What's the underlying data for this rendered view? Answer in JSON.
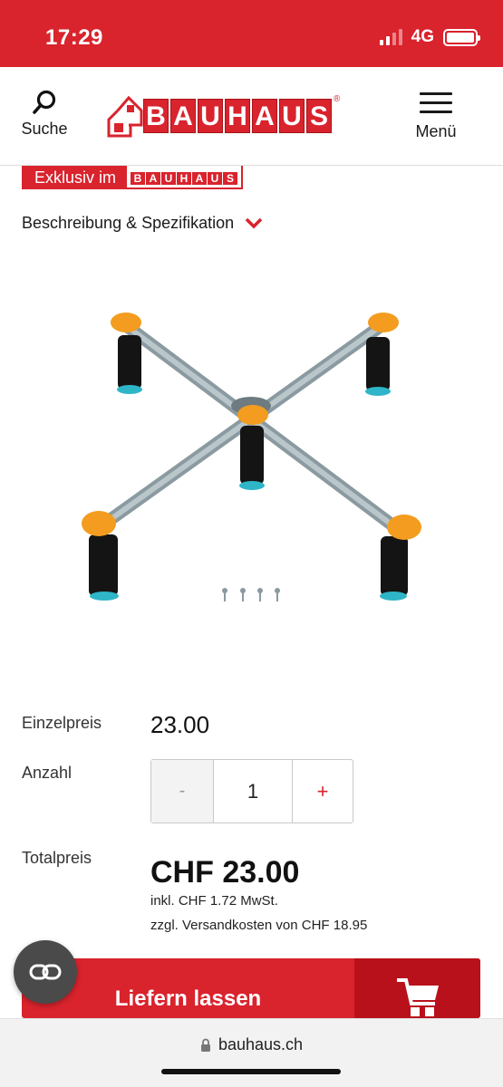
{
  "status_bar": {
    "time": "17:29",
    "network": "4G",
    "battery_level": 1.0,
    "signal_bars_active": 2,
    "signal_bars_total": 4
  },
  "header": {
    "search_label": "Suche",
    "menu_label": "Menü",
    "logo_text": "BAUHAUS",
    "logo_registered": "®"
  },
  "badge": {
    "text": "Exklusiv im",
    "logo_text": "BAUHAUS"
  },
  "description": {
    "label": "Beschreibung & Spezifikation"
  },
  "product": {
    "image": "shower-tray-support-frame"
  },
  "pricing": {
    "unit_price_label": "Einzelpreis",
    "unit_price": "23.00",
    "quantity_label": "Anzahl",
    "quantity_minus": "-",
    "quantity_value": "1",
    "quantity_plus": "+",
    "total_label": "Totalpreis",
    "total_price": "CHF 23.00",
    "vat_note": "inkl. CHF 1.72 MwSt.",
    "shipping_note": "zzgl. Versandkosten von CHF 18.95"
  },
  "deliver_button": {
    "label": "Liefern lassen",
    "icon": "cart-icon"
  },
  "browser": {
    "url": "bauhaus.ch"
  },
  "colors": {
    "brand_red": "#d9232d",
    "brand_dark_red": "#b8111b",
    "accent_orange": "#f39c1f"
  }
}
